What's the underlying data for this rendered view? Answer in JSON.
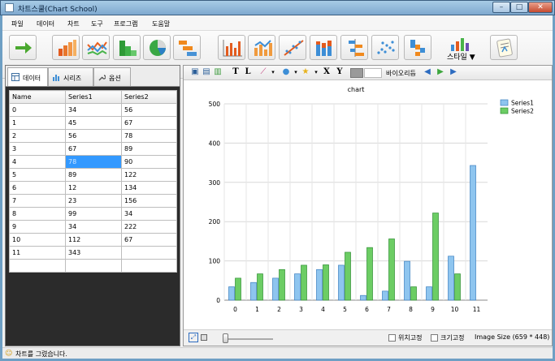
{
  "window": {
    "title": "차트스쿨(Chart School)"
  },
  "menu": [
    "파일",
    "데이터",
    "차트",
    "도구",
    "프로그램",
    "도움말"
  ],
  "toolbar": {
    "style_label": "스타일 ▼",
    "buttons": [
      "arrow-icon",
      "bar-chart-icon",
      "line-chart-icon",
      "step-chart-icon",
      "pie-chart-icon",
      "gantt-chart-icon",
      "column-grid-icon",
      "bar-line-icon",
      "scatter-trend-icon",
      "stacked-bar-icon",
      "diverging-bar-icon",
      "scatter-icon",
      "waterfall-icon",
      "style-icon",
      "notes-icon"
    ]
  },
  "tabs": [
    "데이터",
    "시리즈",
    "옵션"
  ],
  "table": {
    "headers": [
      "Name",
      "Series1",
      "Series2"
    ],
    "rows": [
      [
        "0",
        "34",
        "56"
      ],
      [
        "1",
        "45",
        "67"
      ],
      [
        "2",
        "56",
        "78"
      ],
      [
        "3",
        "67",
        "89"
      ],
      [
        "4",
        "78",
        "90"
      ],
      [
        "5",
        "89",
        "122"
      ],
      [
        "6",
        "12",
        "134"
      ],
      [
        "7",
        "23",
        "156"
      ],
      [
        "8",
        "99",
        "34"
      ],
      [
        "9",
        "34",
        "222"
      ],
      [
        "10",
        "112",
        "67"
      ],
      [
        "11",
        "343",
        ""
      ],
      [
        "",
        "",
        ""
      ]
    ],
    "selected": {
      "row": 4,
      "col": 1
    }
  },
  "chart_toolbar": {
    "text_t": "T",
    "text_l": "L",
    "x_label": "X",
    "y_label": "Y",
    "orientation_label": "바이오리듬"
  },
  "chart_data": {
    "type": "bar",
    "title": "chart",
    "categories": [
      "0",
      "1",
      "2",
      "3",
      "4",
      "5",
      "6",
      "7",
      "8",
      "9",
      "10",
      "11"
    ],
    "series": [
      {
        "name": "Series1",
        "color": "#8ec5ef",
        "values": [
          34,
          45,
          56,
          67,
          78,
          89,
          12,
          23,
          99,
          34,
          112,
          343
        ]
      },
      {
        "name": "Series2",
        "color": "#6ccd64",
        "values": [
          56,
          67,
          78,
          89,
          90,
          122,
          134,
          156,
          34,
          222,
          67,
          null
        ]
      }
    ],
    "ylim": [
      0,
      500
    ],
    "yticks": [
      0,
      100,
      200,
      300,
      400,
      500
    ],
    "grid": true,
    "legend": "top-right"
  },
  "chart_footer": {
    "fix_position": "위치고정",
    "fix_size": "크기고정",
    "image_size": "Image Size (659 * 448)"
  },
  "status": "차트를 그렸습니다."
}
